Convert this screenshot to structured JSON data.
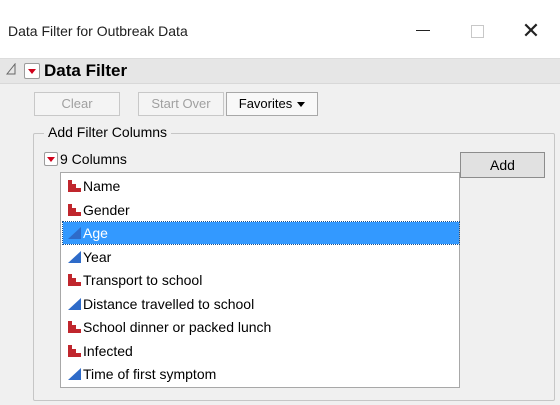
{
  "window": {
    "title": "Data Filter for Outbreak Data",
    "controls": {
      "minimize": "minimize",
      "maximize": "maximize",
      "close": "✕"
    }
  },
  "outline": {
    "title": "Data Filter"
  },
  "buttons": {
    "clear": "Clear",
    "start_over": "Start Over",
    "favorites": "Favorites"
  },
  "add_filter": {
    "legend": "Add Filter Columns",
    "columns_header": "9 Columns",
    "add_label": "Add",
    "selected_index": 2,
    "columns": [
      {
        "label": "Name",
        "type": "nominal"
      },
      {
        "label": "Gender",
        "type": "nominal"
      },
      {
        "label": "Age",
        "type": "continuous"
      },
      {
        "label": "Year",
        "type": "continuous"
      },
      {
        "label": "Transport to school",
        "type": "nominal"
      },
      {
        "label": "Distance travelled to school",
        "type": "continuous"
      },
      {
        "label": "School dinner or packed lunch",
        "type": "nominal"
      },
      {
        "label": "Infected",
        "type": "nominal"
      },
      {
        "label": "Time of first symptom",
        "type": "continuous"
      }
    ]
  },
  "colors": {
    "nominal_icon": "#c0262d",
    "continuous_icon": "#2e6bc9",
    "selection": "#3399ff"
  }
}
